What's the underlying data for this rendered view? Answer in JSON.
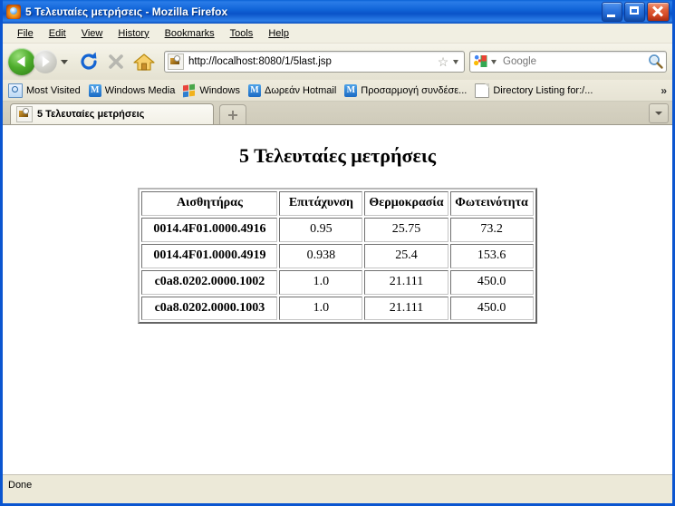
{
  "window": {
    "title": "5 Τελευταίες μετρήσεις - Mozilla Firefox",
    "favicon": "firefox-icon",
    "minimize_label": "Minimize",
    "maximize_label": "Maximize",
    "close_label": "Close"
  },
  "menubar": {
    "items": [
      {
        "label": "File",
        "accesskey": "F"
      },
      {
        "label": "Edit",
        "accesskey": "E"
      },
      {
        "label": "View",
        "accesskey": "V"
      },
      {
        "label": "History",
        "accesskey": "s"
      },
      {
        "label": "Bookmarks",
        "accesskey": "B"
      },
      {
        "label": "Tools",
        "accesskey": "T"
      },
      {
        "label": "Help",
        "accesskey": "H"
      }
    ]
  },
  "toolbar": {
    "back_icon": "back-arrow-icon",
    "forward_icon": "forward-arrow-icon",
    "history_dropdown_icon": "chevron-down-icon",
    "reload_icon": "reload-icon",
    "stop_icon": "stop-icon",
    "home_icon": "home-icon",
    "address": {
      "favicon": "page-favicon",
      "url": "http://localhost:8080/1/5last.jsp",
      "bookmark_icon": "star-icon",
      "dropdown_icon": "chevron-down-icon"
    },
    "search": {
      "engine_icon": "google-icon",
      "engine_dropdown_icon": "chevron-down-icon",
      "placeholder": "Google",
      "submit_icon": "magnifier-icon"
    }
  },
  "bookmarks_bar": {
    "items": [
      {
        "label": "Most Visited",
        "icon": "most-visited-icon"
      },
      {
        "label": "Windows Media",
        "icon": "windows-media-icon"
      },
      {
        "label": "Windows",
        "icon": "windows-logo-icon"
      },
      {
        "label": "Δωρεάν Hotmail",
        "icon": "windows-media-icon"
      },
      {
        "label": "Προσαρμογή συνδέσε...",
        "icon": "windows-media-icon"
      },
      {
        "label": "Directory Listing for:/...",
        "icon": "document-icon"
      }
    ],
    "overflow_label": "»"
  },
  "tabs": {
    "items": [
      {
        "label": "5 Τελευταίες μετρήσεις",
        "favicon": "page-favicon",
        "active": true
      }
    ],
    "new_tab_label": "+",
    "tab_list_icon": "chevron-down-icon"
  },
  "page": {
    "heading": "5 Τελευταίες μετρήσεις",
    "table": {
      "headers": [
        "Αισθητήρας",
        "Επιτάχυνση",
        "Θερμοκρασία",
        "Φωτεινότητα"
      ],
      "rows": [
        [
          "0014.4F01.0000.4916",
          "0.95",
          "25.75",
          "73.2"
        ],
        [
          "0014.4F01.0000.4919",
          "0.938",
          "25.4",
          "153.6"
        ],
        [
          "c0a8.0202.0000.1002",
          "1.0",
          "21.111",
          "450.0"
        ],
        [
          "c0a8.0202.0000.1003",
          "1.0",
          "21.111",
          "450.0"
        ]
      ]
    }
  },
  "statusbar": {
    "text": "Done"
  },
  "colors": {
    "titlebar_blue": "#0a55d0",
    "chrome_beige": "#ece9d8",
    "content_white": "#ffffff",
    "close_red": "#cc3513",
    "back_green": "#4fae2d"
  }
}
